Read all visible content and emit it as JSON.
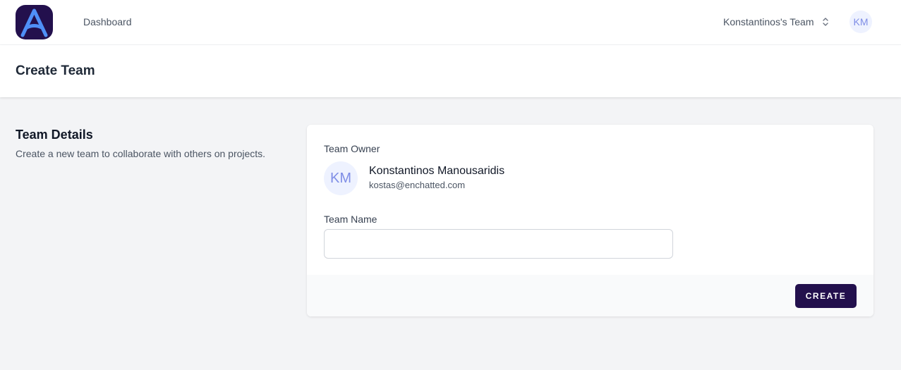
{
  "nav": {
    "links": [
      "Dashboard"
    ],
    "team_switcher": "Konstantinos's Team",
    "user_initials": "KM"
  },
  "header": {
    "title": "Create Team"
  },
  "section": {
    "title": "Team Details",
    "description": "Create a new team to collaborate with others on projects."
  },
  "form": {
    "owner_label": "Team Owner",
    "owner": {
      "initials": "KM",
      "name": "Konstantinos Manousaridis",
      "email": "kostas@enchatted.com"
    },
    "team_name_label": "Team Name",
    "team_name_value": "",
    "submit_label": "CREATE"
  },
  "colors": {
    "brand_dark": "#23104d",
    "logo_accent": "#4f8ff7",
    "avatar_bg": "#eef2ff",
    "avatar_text": "#7f8ee6"
  },
  "icons": {
    "logo": "app-logo-icon",
    "team_switcher": "chevron-up-down-icon"
  }
}
